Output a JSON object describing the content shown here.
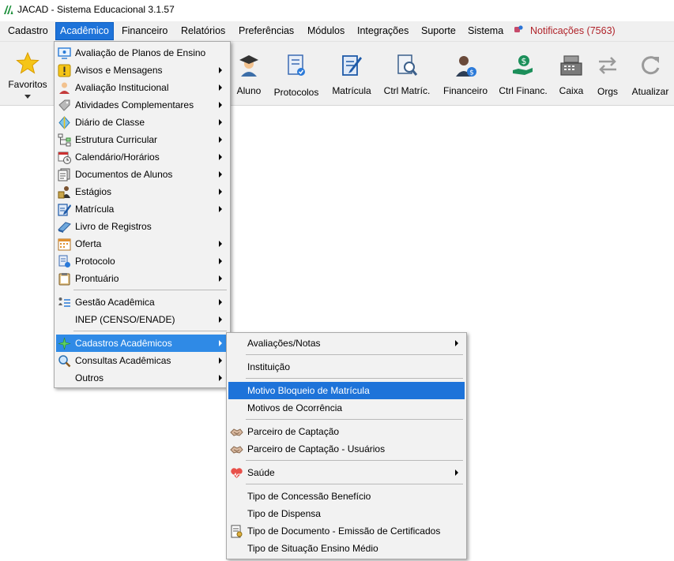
{
  "window": {
    "title": "JACAD - Sistema Educacional 3.1.57"
  },
  "menubar": {
    "items": [
      {
        "label": "Cadastro"
      },
      {
        "label": "Acadêmico"
      },
      {
        "label": "Financeiro"
      },
      {
        "label": "Relatórios"
      },
      {
        "label": "Preferências"
      },
      {
        "label": "Módulos"
      },
      {
        "label": "Integrações"
      },
      {
        "label": "Suporte"
      },
      {
        "label": "Sistema"
      }
    ],
    "notifications": "Notificações (7563)"
  },
  "toolbar": {
    "favorites": "Favoritos",
    "buttons": [
      {
        "label": "Aluno",
        "icon": "student-icon"
      },
      {
        "label": "Protocolos",
        "icon": "protocol-icon"
      },
      {
        "label": "Matrícula",
        "icon": "enrollment-icon"
      },
      {
        "label": "Ctrl Matríc.",
        "icon": "enrollment-control-icon"
      },
      {
        "label": "Financeiro",
        "icon": "finance-icon"
      },
      {
        "label": "Ctrl Financ.",
        "icon": "finance-control-icon"
      },
      {
        "label": "Caixa",
        "icon": "cash-register-icon"
      },
      {
        "label": "Orgs",
        "icon": "swap-arrows-icon"
      },
      {
        "label": "Atualizar",
        "icon": "refresh-icon"
      }
    ]
  },
  "academic_menu": {
    "items": [
      {
        "label": "Avaliação de Planos de Ensino"
      },
      {
        "label": "Avisos e Mensagens"
      },
      {
        "label": "Avaliação Institucional"
      },
      {
        "label": "Atividades Complementares"
      },
      {
        "label": "Diário de Classe"
      },
      {
        "label": "Estrutura Curricular"
      },
      {
        "label": "Calendário/Horários"
      },
      {
        "label": "Documentos de Alunos"
      },
      {
        "label": "Estágios"
      },
      {
        "label": "Matrícula"
      },
      {
        "label": "Livro de Registros"
      },
      {
        "label": "Oferta"
      },
      {
        "label": "Protocolo"
      },
      {
        "label": "Prontuário"
      },
      {
        "label": "Gestão Acadêmica"
      },
      {
        "label": "INEP (CENSO/ENADE)"
      },
      {
        "label": "Cadastros Acadêmicos"
      },
      {
        "label": "Consultas Acadêmicas"
      },
      {
        "label": "Outros"
      }
    ]
  },
  "cadastros_submenu": {
    "items": [
      {
        "label": "Avaliações/Notas"
      },
      {
        "label": "Instituição"
      },
      {
        "label": "Motivo Bloqueio de Matrícula"
      },
      {
        "label": "Motivos de Ocorrência"
      },
      {
        "label": "Parceiro de Captação"
      },
      {
        "label": "Parceiro de Captação - Usuários"
      },
      {
        "label": "Saúde"
      },
      {
        "label": "Tipo de Concessão Benefício"
      },
      {
        "label": "Tipo de Dispensa"
      },
      {
        "label": "Tipo de Documento - Emissão de Certificados"
      },
      {
        "label": "Tipo de Situação Ensino Médio"
      }
    ]
  },
  "colors": {
    "highlight": "#1e73d9",
    "hover": "#2f8ae6",
    "notification": "#b0232a"
  }
}
